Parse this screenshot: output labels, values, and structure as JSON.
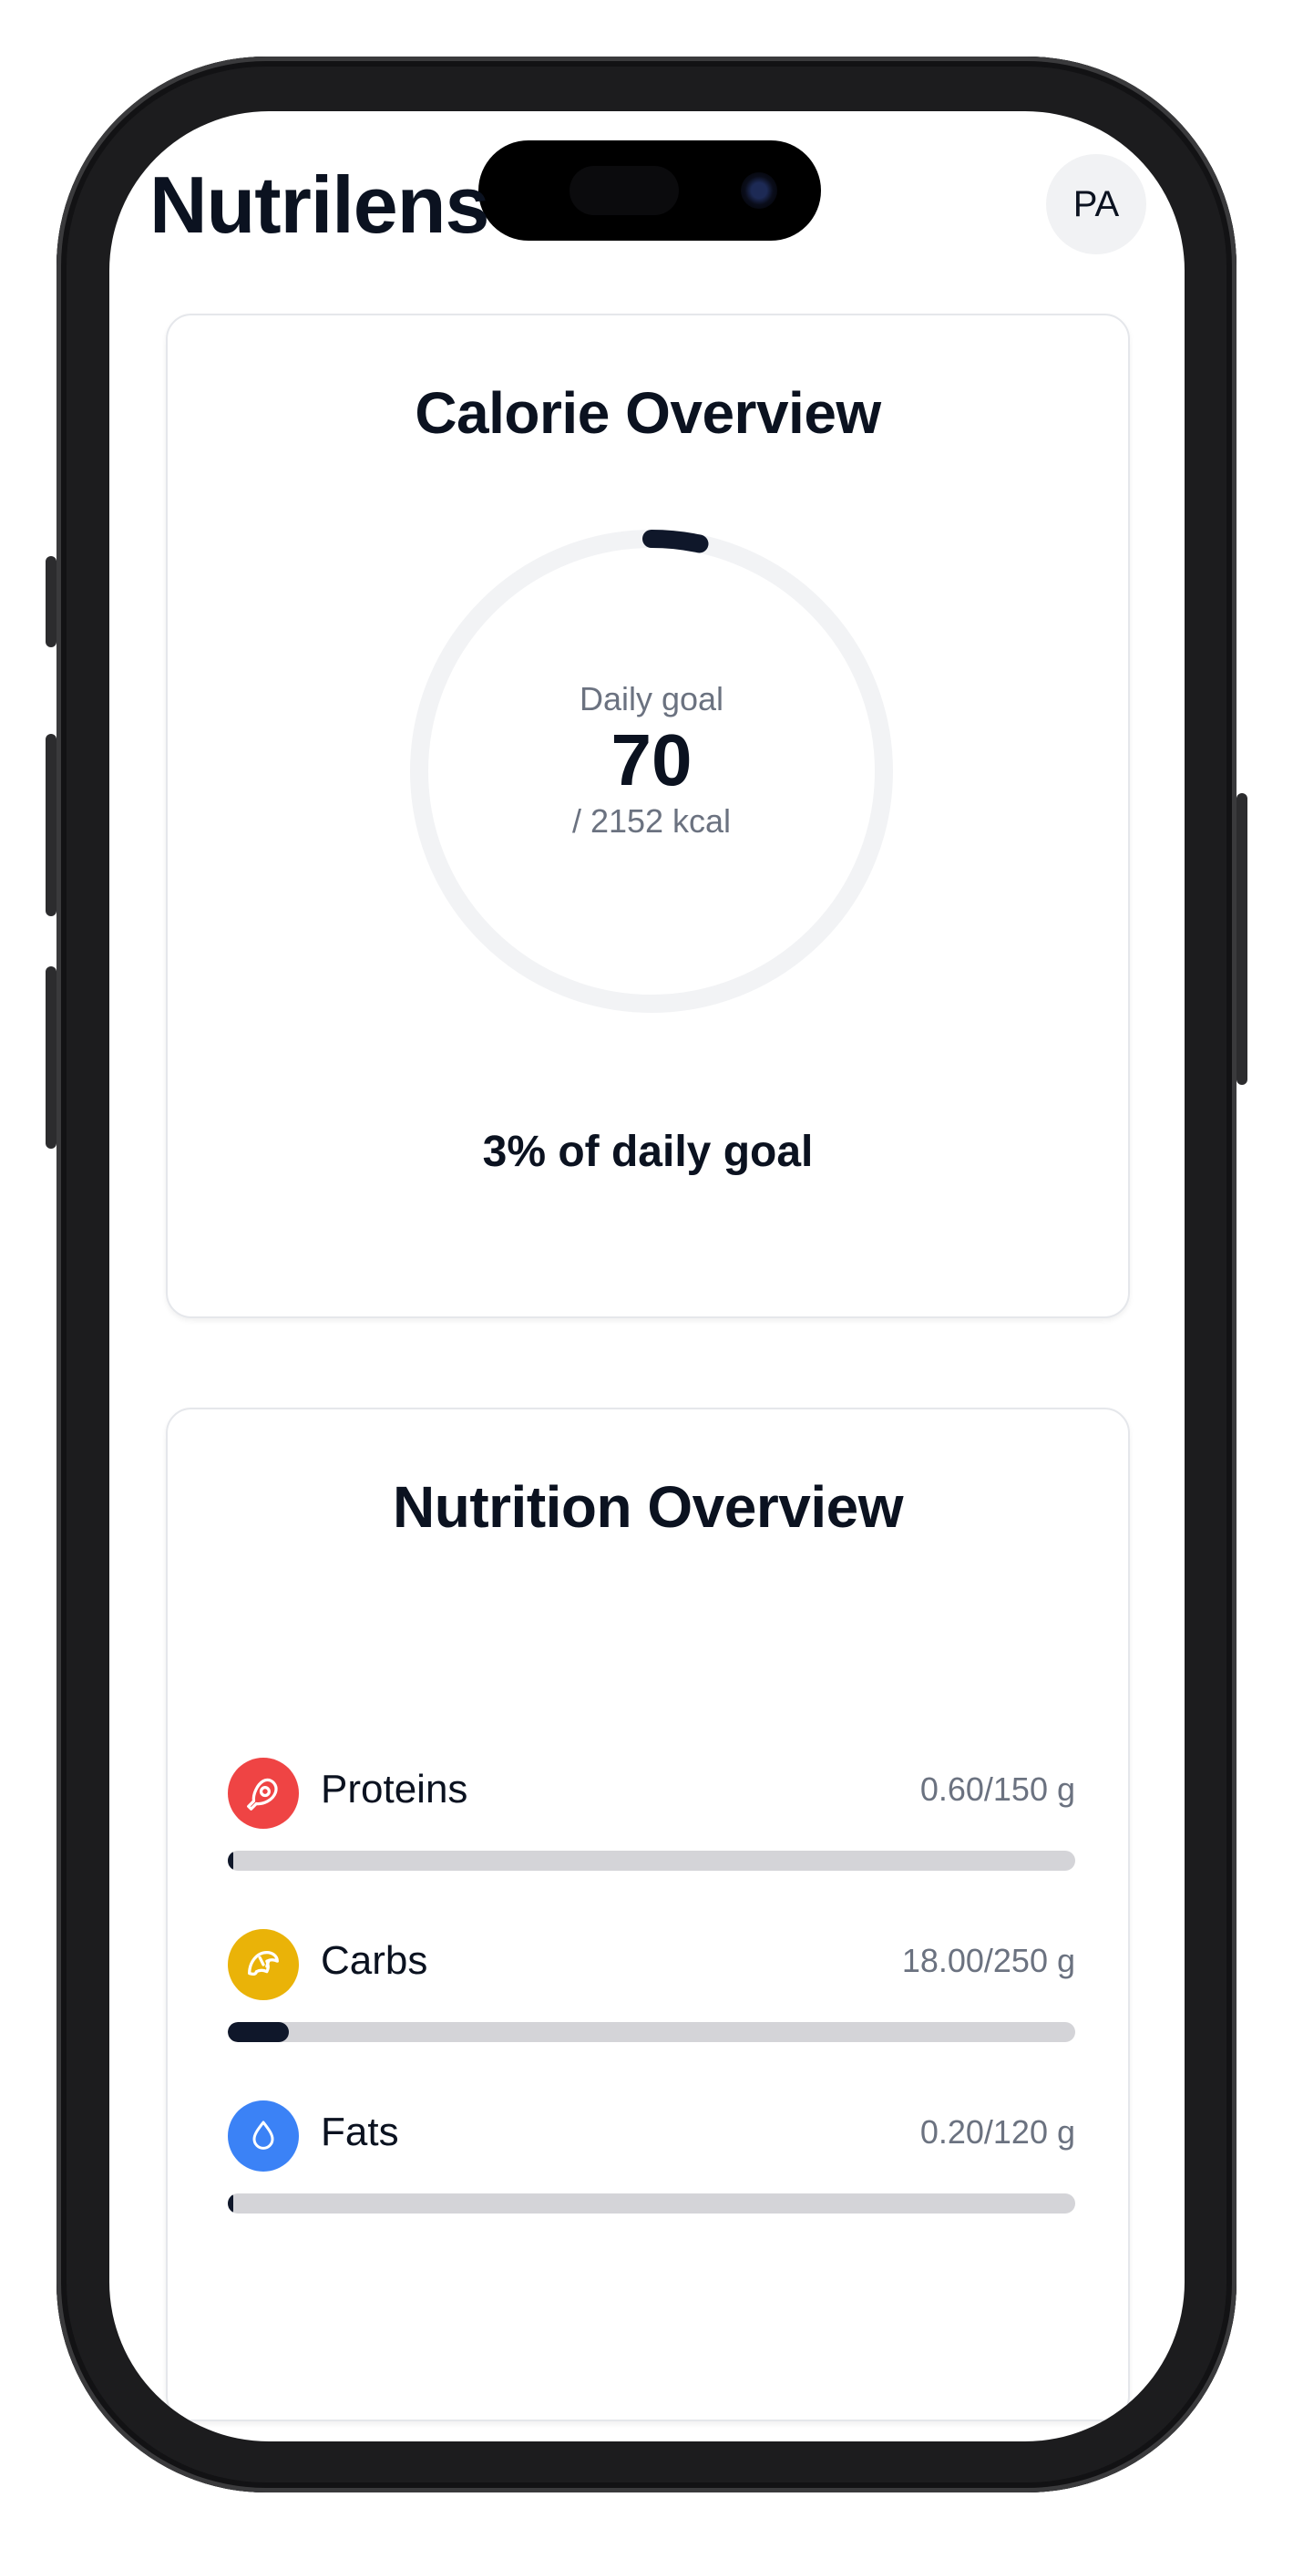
{
  "app": {
    "title": "Nutrilens",
    "avatar_initials": "PA"
  },
  "calorie_overview": {
    "title": "Calorie Overview",
    "ring_label": "Daily goal",
    "consumed": "70",
    "goal_text": "/ 2152 kcal",
    "percent_text": "3% of daily goal",
    "progress_fraction": 0.033,
    "ring_color": "#0f172a",
    "ring_track_color": "#f2f3f5"
  },
  "nutrition_overview": {
    "title": "Nutrition Overview",
    "macros": [
      {
        "name": "Proteins",
        "amount": "0.60/150 g",
        "fraction": 0.004,
        "icon": "meat-icon",
        "color": "#ef4444"
      },
      {
        "name": "Carbs",
        "amount": "18.00/250 g",
        "fraction": 0.072,
        "icon": "croissant-icon",
        "color": "#eab308"
      },
      {
        "name": "Fats",
        "amount": "0.20/120 g",
        "fraction": 0.0017,
        "icon": "droplet-icon",
        "color": "#3b82f6"
      }
    ]
  }
}
